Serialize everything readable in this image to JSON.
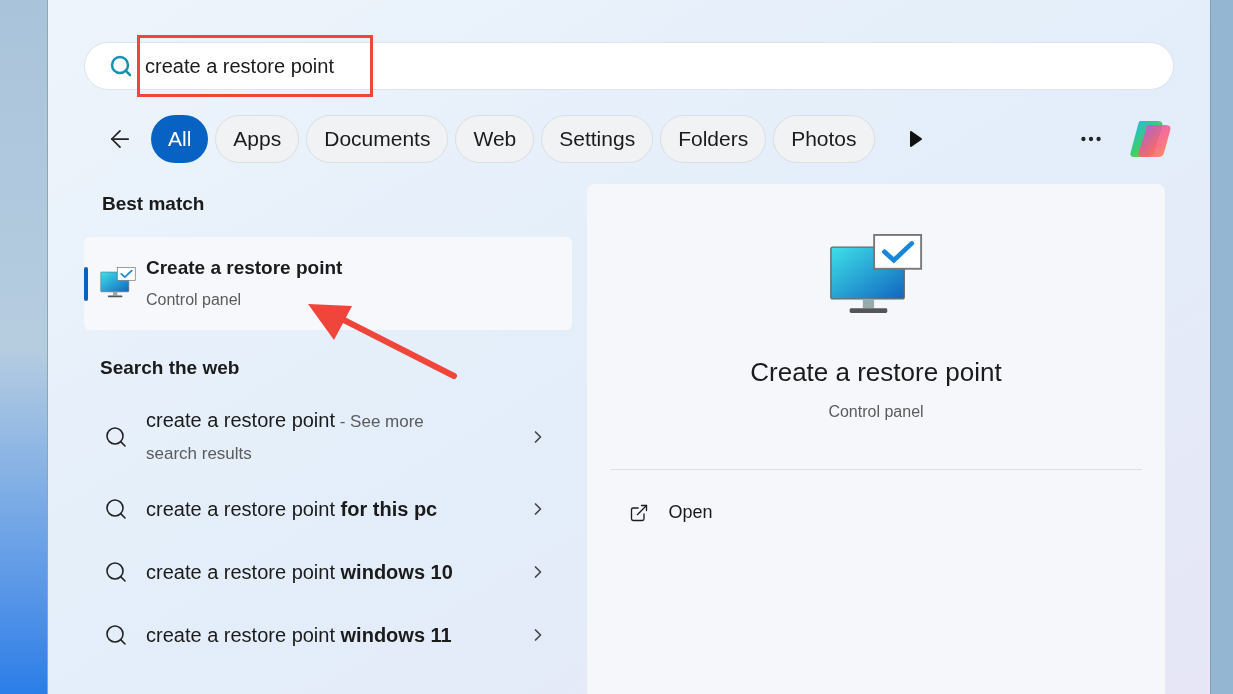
{
  "search": {
    "value": "create a restore point"
  },
  "filters": [
    {
      "label": "All",
      "selected": true
    },
    {
      "label": "Apps",
      "selected": false
    },
    {
      "label": "Documents",
      "selected": false
    },
    {
      "label": "Web",
      "selected": false
    },
    {
      "label": "Settings",
      "selected": false
    },
    {
      "label": "Folders",
      "selected": false
    },
    {
      "label": "Photos",
      "selected": false
    }
  ],
  "best_match": {
    "heading": "Best match",
    "title": "Create a restore point",
    "subtitle": "Control panel",
    "selected": true
  },
  "web": {
    "heading": "Search the web",
    "results": [
      {
        "text": "create a restore point",
        "note": "- See more search results"
      },
      {
        "text": "create a restore point **for this pc**"
      },
      {
        "text": "create a restore point **windows 10**"
      },
      {
        "text": "create a restore point **windows 11**"
      }
    ]
  },
  "preview": {
    "title": "Create a restore point",
    "subtitle": "Control panel",
    "actions": [
      {
        "label": "Open"
      }
    ]
  }
}
